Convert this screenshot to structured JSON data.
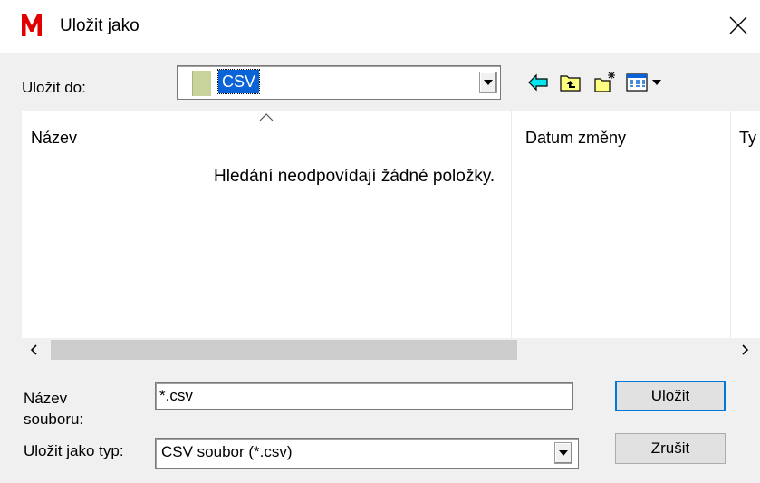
{
  "window": {
    "title": "Uložit jako",
    "logo_color": "#e00000"
  },
  "location": {
    "label": "Uložit do:",
    "current": "CSV",
    "toolbar_icons": [
      "back-arrow-icon",
      "up-folder-icon",
      "new-folder-icon",
      "view-menu-icon"
    ]
  },
  "file_list": {
    "columns": [
      "Název",
      "Datum změny",
      "Ty"
    ],
    "sorted_column": "Název",
    "empty_message": "Hledání neodpovídají žádné položky."
  },
  "fields": {
    "filename_label": "Název\nsouboru:",
    "filename_value": "*.csv",
    "filetype_label": "Uložit jako typ:",
    "filetype_value": "CSV soubor (*.csv)"
  },
  "buttons": {
    "save": "Uložit",
    "cancel": "Zrušit"
  },
  "colors": {
    "selection": "#0a64d8",
    "focus_border": "#0078d7"
  }
}
